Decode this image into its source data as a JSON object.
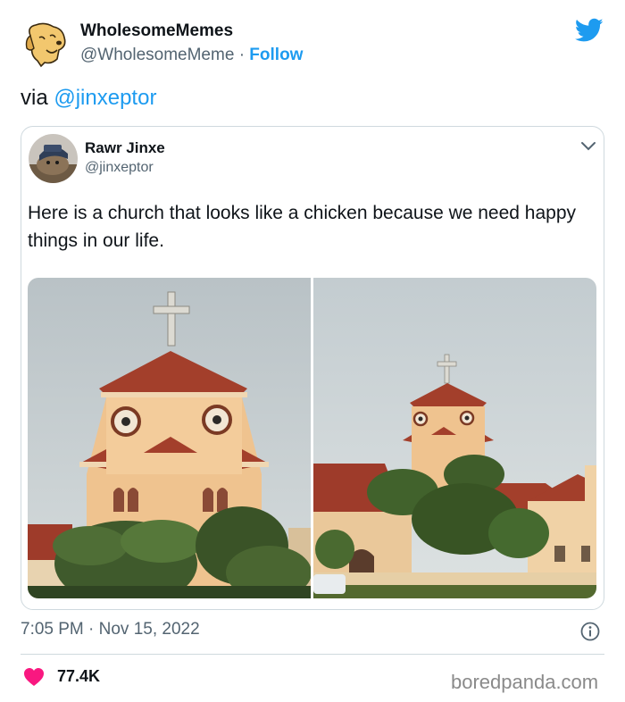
{
  "author": {
    "name": "WholesomeMemes",
    "handle": "@WholesomeMeme",
    "separator": "·",
    "follow_label": "Follow",
    "avatar_icon": "dog-avatar-icon",
    "platform_icon": "twitter-bird-icon"
  },
  "tweet": {
    "text_prefix": "via",
    "mention": "@jinxeptor"
  },
  "quoted": {
    "name": "Rawr Jinxe",
    "handle": "@jinxeptor",
    "text": "Here is a church that looks like a chicken because we need happy things in our life.",
    "menu_icon": "chevron-down-icon",
    "photos": [
      "church-closeup-photo",
      "church-wide-photo"
    ]
  },
  "footer": {
    "timestamp": "7:05 PM · Nov 15, 2022",
    "like_count": "77.4K",
    "like_icon": "heart-icon",
    "info_icon": "info-icon"
  },
  "watermark": "boredpanda.com",
  "colors": {
    "accent": "#1d9bf0",
    "heart": "#f91880",
    "text": "#0f1419",
    "secondary": "#536471",
    "border": "#cfd9de"
  }
}
